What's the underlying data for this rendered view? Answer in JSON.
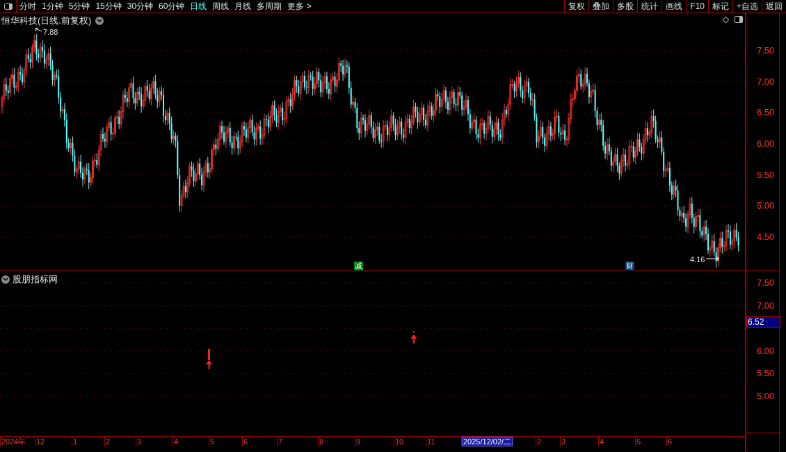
{
  "toolbar": {
    "periods": [
      {
        "label": "分时",
        "selected": false
      },
      {
        "label": "1分钟",
        "selected": false
      },
      {
        "label": "5分钟",
        "selected": false
      },
      {
        "label": "15分钟",
        "selected": false
      },
      {
        "label": "30分钟",
        "selected": false
      },
      {
        "label": "60分钟",
        "selected": false
      },
      {
        "label": "日线",
        "selected": true
      },
      {
        "label": "周线",
        "selected": false
      },
      {
        "label": "月线",
        "selected": false
      },
      {
        "label": "多周期",
        "selected": false
      },
      {
        "label": "更多 >",
        "selected": false
      }
    ],
    "actions": [
      "复权",
      "叠加",
      "多股",
      "统计",
      "画线",
      "F10",
      "标记",
      "+自选",
      "返回"
    ]
  },
  "main_chart": {
    "title": "恒华科技(日线.前复权)",
    "y_labels": [
      "7.50",
      "7.00",
      "6.50",
      "6.00",
      "5.50",
      "5.00",
      "4.50"
    ],
    "high_label": "7.88",
    "low_label": "4.16",
    "markers": [
      {
        "text": "减",
        "color": "#008000"
      },
      {
        "text": "财",
        "color": "#0a3a6e"
      }
    ]
  },
  "indicator": {
    "title": "股朋指标网",
    "y_labels": [
      "7.50",
      "7.00",
      "6.00",
      "5.50",
      "5.00"
    ],
    "current_value": "6.52"
  },
  "date_axis": [
    {
      "label": "2024年",
      "selected": false
    },
    {
      "label": "12",
      "selected": false
    },
    {
      "label": "1",
      "selected": false
    },
    {
      "label": "2",
      "selected": false
    },
    {
      "label": "3",
      "selected": false
    },
    {
      "label": "4",
      "selected": false
    },
    {
      "label": "5",
      "selected": false
    },
    {
      "label": "6",
      "selected": false
    },
    {
      "label": "7",
      "selected": false
    },
    {
      "label": "8",
      "selected": false
    },
    {
      "label": "9",
      "selected": false
    },
    {
      "label": "10",
      "selected": false
    },
    {
      "label": "11",
      "selected": false
    },
    {
      "label": "2025/12/02/二",
      "selected": true
    },
    {
      "label": "2",
      "selected": false
    },
    {
      "label": "3",
      "selected": false
    },
    {
      "label": "4",
      "selected": false
    },
    {
      "label": "5",
      "selected": false
    },
    {
      "label": "6",
      "selected": false
    }
  ]
}
